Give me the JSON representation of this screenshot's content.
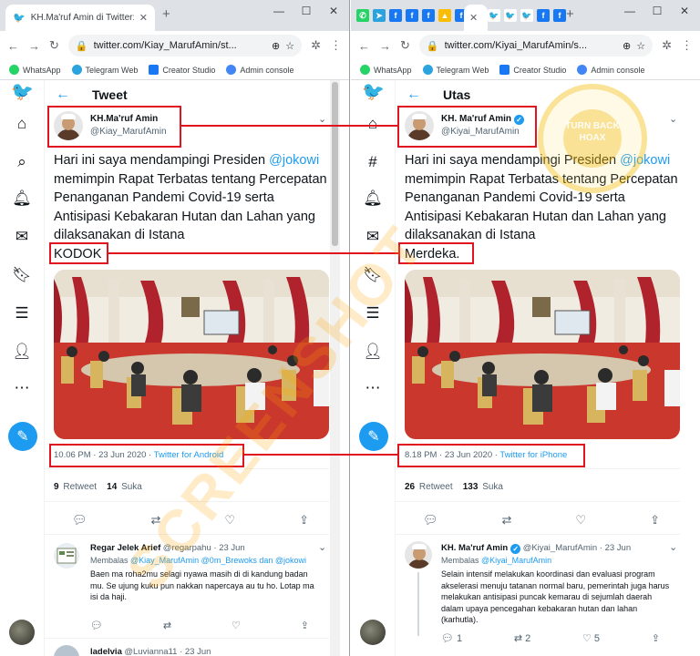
{
  "left": {
    "tab_title": "KH.Ma'ruf Amin di Twitter: \"Hari i",
    "url": "twitter.com/Kiay_MarufAmin/st...",
    "header_title": "Tweet",
    "author": {
      "name": "KH.Ma'ruf Amin",
      "handle": "@Kiay_MarufAmin"
    },
    "tweet": {
      "pre": "Hari ini saya mendampingi Presiden ",
      "mention": "@jokowi",
      "post": " memimpin Rapat Terbatas tentang Percepatan Penanganan Pandemi Covid-19 serta Antisipasi Kebakaran Hutan dan Lahan yang dilaksanakan di Istana",
      "last": "KODOK"
    },
    "meta": {
      "time": "10.06 PM · 23 Jun 2020 · ",
      "source": "Twitter for Android"
    },
    "stats": {
      "retweets": "9",
      "retweet_label": "Retweet",
      "likes": "14",
      "like_label": "Suka"
    },
    "reply": {
      "name": "Regar Jelek Arief",
      "handle": "@regarpahu · 23 Jun",
      "replying": "Membalas ",
      "mention1": "@Kiay_MarufAmin @0m_Brewoks dan @jokowi",
      "text": "Baen ma roha2mu selagi nyawa masih di di kandung badan mu. Se ujung kuku pun nakkan napercaya au tu ho. Lotap ma isi da haji."
    },
    "reply2": {
      "name": "ladelvia",
      "handle": "@Luvianna11 · 23 Jun"
    }
  },
  "right": {
    "url": "twitter.com/Kiyai_MarufAmin/s...",
    "header_title": "Utas",
    "author": {
      "name": "KH. Ma'ruf Amin",
      "handle": "@Kiyai_MarufAmin"
    },
    "tweet": {
      "pre": "Hari ini saya mendampingi Presiden ",
      "mention": "@jokowi",
      "post": " memimpin Rapat Terbatas tentang Percepatan Penanganan Pandemi Covid-19 serta Antisipasi Kebakaran Hutan dan Lahan yang dilaksanakan di Istana",
      "last": "Merdeka."
    },
    "meta": {
      "time": "8.18 PM · 23 Jun 2020 · ",
      "source": "Twitter for iPhone"
    },
    "stats": {
      "retweets": "26",
      "retweet_label": "Retweet",
      "likes": "133",
      "like_label": "Suka"
    },
    "reply": {
      "name": "KH. Ma'ruf Amin",
      "handle": "@Kiyai_MarufAmin · 23 Jun",
      "replying": "Membalas ",
      "mention1": "@Kiyai_MarufAmin",
      "text": "Selain intensif melakukan koordinasi dan evaluasi program akselerasi menuju tatanan normal baru, pemerintah juga harus melakukan antisipasi puncak kemarau di sejumlah daerah dalam upaya pencegahan kebakaran hutan dan lahan (karhutla).",
      "reply_count": "1",
      "rt_count": "2",
      "like_count": "5"
    }
  },
  "bookmarks": [
    "WhatsApp",
    "Telegram Web",
    "Creator Studio",
    "Admin console"
  ],
  "watermark": "SCREENSHOT",
  "seal_text": "TURN BACK HOAX",
  "colors": {
    "twitter_blue": "#1d9bf0",
    "highlight_red": "#e0141e",
    "watermark": "#ffa500"
  }
}
